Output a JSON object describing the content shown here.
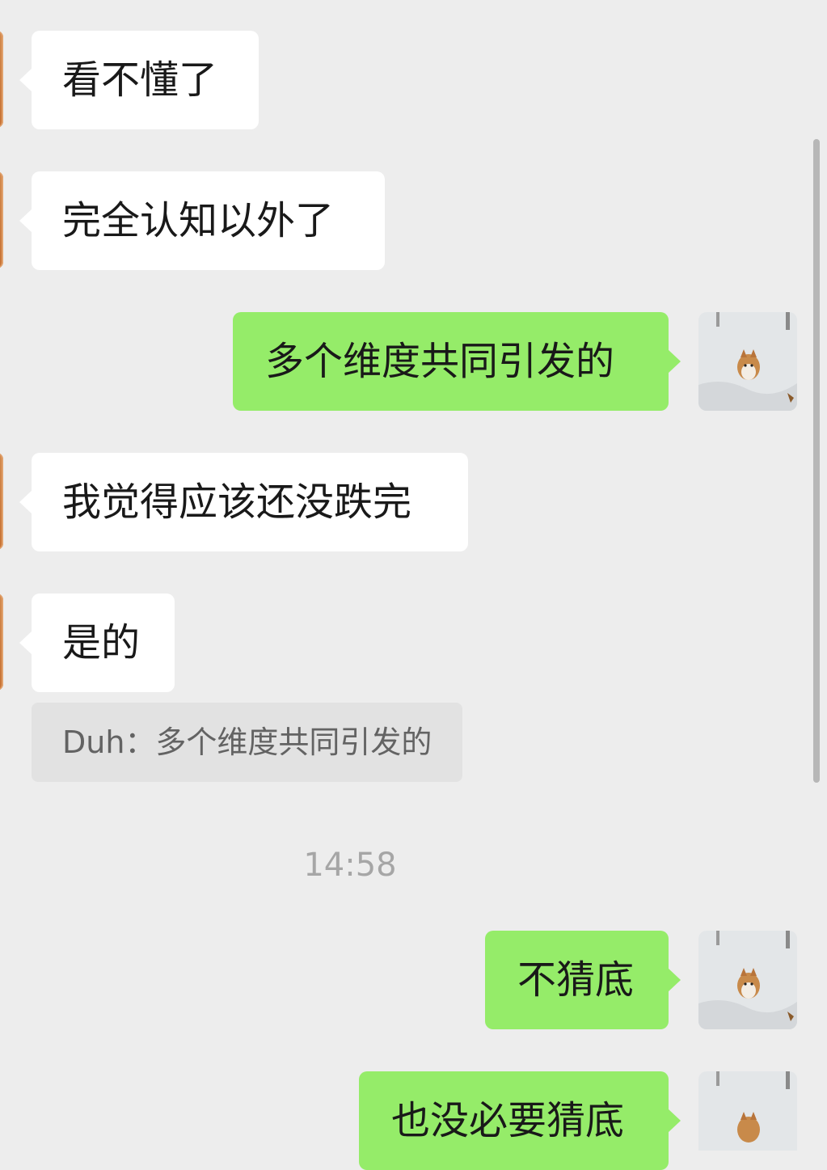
{
  "messages": [
    {
      "side": "in",
      "text": "看不懂了"
    },
    {
      "side": "in",
      "text": "完全认知以外了"
    },
    {
      "side": "out",
      "text": "多个维度共同引发的"
    },
    {
      "side": "in",
      "text": "我觉得应该还没跌完"
    },
    {
      "side": "in",
      "text": "是的"
    },
    {
      "side": "out",
      "text": "不猜底"
    },
    {
      "side": "out",
      "text": "也没必要猜底"
    }
  ],
  "quote": {
    "text": "Duh：多个维度共同引发的"
  },
  "timestamp": "14:58",
  "colors": {
    "background": "#ededed",
    "incoming_bubble": "#ffffff",
    "outgoing_bubble": "#95ec69",
    "quote_bg": "#e2e2e2"
  },
  "icons": {
    "my_avatar": "corgi-in-snow-photo",
    "contact_avatar": "orange-avatar"
  }
}
